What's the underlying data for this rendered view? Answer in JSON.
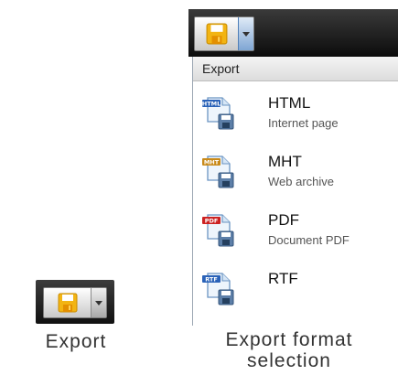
{
  "left": {
    "caption": "Export"
  },
  "right": {
    "caption": "Export format selection",
    "menu_header": "Export",
    "items": [
      {
        "name": "HTML",
        "desc": "Internet page",
        "icon": "html-file-icon",
        "badge": "HTML",
        "badge_color": "#2a62b8"
      },
      {
        "name": "MHT",
        "desc": "Web archive",
        "icon": "mht-file-icon",
        "badge": "MHT",
        "badge_color": "#c98a1a"
      },
      {
        "name": "PDF",
        "desc": "Document PDF",
        "icon": "pdf-file-icon",
        "badge": "PDF",
        "badge_color": "#cc2222"
      },
      {
        "name": "RTF",
        "desc": "",
        "icon": "rtf-file-icon",
        "badge": "RTF",
        "badge_color": "#2a62b8"
      }
    ]
  }
}
